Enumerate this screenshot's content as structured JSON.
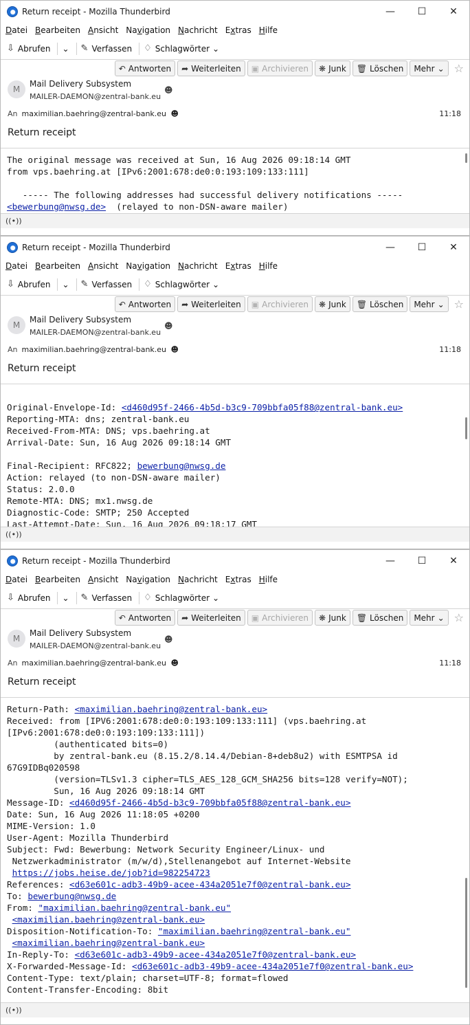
{
  "windows": [
    {
      "title": "Return receipt - Mozilla Thunderbird",
      "menu": [
        "Datei",
        "Bearbeiten",
        "Ansicht",
        "Navigation",
        "Nachricht",
        "Extras",
        "Hilfe"
      ],
      "toolbar": {
        "get": "Abrufen",
        "compose": "Verfassen",
        "tags": "Schlagwörter"
      },
      "actions": {
        "reply": "Antworten",
        "forward": "Weiterleiten",
        "archive": "Archivieren",
        "junk": "Junk",
        "delete": "Löschen",
        "more": "Mehr"
      },
      "from_name": "Mail Delivery Subsystem",
      "from_addr": "MAILER-DAEMON@zentral-bank.eu",
      "to_label": "An",
      "to_addr": "maximilian.baehring@zentral-bank.eu",
      "time": "11:18",
      "subject": "Return receipt",
      "body_lines": [
        [
          {
            "t": "The original message was received at Sun, 16 Aug 2026 09:18:14 GMT"
          }
        ],
        [
          {
            "t": "from vps.baehring.at [IPv6:2001:678:de0:0:193:109:133:111]"
          }
        ],
        [
          {
            "t": ""
          }
        ],
        [
          {
            "t": "   ----- The following addresses had successful delivery notifications -----"
          }
        ],
        [
          {
            "t": "<bewerbung@nwsg.de>",
            "link": true
          },
          {
            "t": "  (relayed to non-DSN-aware mailer)"
          }
        ]
      ]
    },
    {
      "title": "Return receipt - Mozilla Thunderbird",
      "menu": [
        "Datei",
        "Bearbeiten",
        "Ansicht",
        "Navigation",
        "Nachricht",
        "Extras",
        "Hilfe"
      ],
      "toolbar": {
        "get": "Abrufen",
        "compose": "Verfassen",
        "tags": "Schlagwörter"
      },
      "actions": {
        "reply": "Antworten",
        "forward": "Weiterleiten",
        "archive": "Archivieren",
        "junk": "Junk",
        "delete": "Löschen",
        "more": "Mehr"
      },
      "from_name": "Mail Delivery Subsystem",
      "from_addr": "MAILER-DAEMON@zentral-bank.eu",
      "to_label": "An",
      "to_addr": "maximilian.baehring@zentral-bank.eu",
      "time": "11:18",
      "subject": "Return receipt",
      "body_lines": [
        [
          {
            "t": ""
          }
        ],
        [
          {
            "t": "Original-Envelope-Id: "
          },
          {
            "t": "<d460d95f-2466-4b5d-b3c9-709bbfa05f88@zentral-bank.eu>",
            "link": true
          }
        ],
        [
          {
            "t": "Reporting-MTA: dns; zentral-bank.eu"
          }
        ],
        [
          {
            "t": "Received-From-MTA: DNS; vps.baehring.at"
          }
        ],
        [
          {
            "t": "Arrival-Date: Sun, 16 Aug 2026 09:18:14 GMT"
          }
        ],
        [
          {
            "t": ""
          }
        ],
        [
          {
            "t": "Final-Recipient: RFC822; "
          },
          {
            "t": "bewerbung@nwsg.de",
            "link": true
          }
        ],
        [
          {
            "t": "Action: relayed (to non-DSN-aware mailer)"
          }
        ],
        [
          {
            "t": "Status: 2.0.0"
          }
        ],
        [
          {
            "t": "Remote-MTA: DNS; mx1.nwsg.de"
          }
        ],
        [
          {
            "t": "Diagnostic-Code: SMTP; 250 Accepted"
          }
        ],
        [
          {
            "t": "Last-Attempt-Date: Sun, 16 Aug 2026 09:18:17 GMT"
          }
        ]
      ]
    },
    {
      "title": "Return receipt - Mozilla Thunderbird",
      "menu": [
        "Datei",
        "Bearbeiten",
        "Ansicht",
        "Navigation",
        "Nachricht",
        "Extras",
        "Hilfe"
      ],
      "toolbar": {
        "get": "Abrufen",
        "compose": "Verfassen",
        "tags": "Schlagwörter"
      },
      "actions": {
        "reply": "Antworten",
        "forward": "Weiterleiten",
        "archive": "Archivieren",
        "junk": "Junk",
        "delete": "Löschen",
        "more": "Mehr"
      },
      "from_name": "Mail Delivery Subsystem",
      "from_addr": "MAILER-DAEMON@zentral-bank.eu",
      "to_label": "An",
      "to_addr": "maximilian.baehring@zentral-bank.eu",
      "time": "11:18",
      "subject": "Return receipt",
      "body_lines": [
        [
          {
            "t": "Return-Path: "
          },
          {
            "t": "<maximilian.baehring@zentral-bank.eu>",
            "link": true
          }
        ],
        [
          {
            "t": "Received: from [IPV6:2001:678:de0:0:193:109:133:111] (vps.baehring.at"
          }
        ],
        [
          {
            "t": "[IPv6:2001:678:de0:0:193:109:133:111])"
          }
        ],
        [
          {
            "t": "         (authenticated bits=0)"
          }
        ],
        [
          {
            "t": "         by zentral-bank.eu (8.15.2/8.14.4/Debian-8+deb8u2) with ESMTPSA id"
          }
        ],
        [
          {
            "t": "67G9IDBq020598"
          }
        ],
        [
          {
            "t": "         (version=TLSv1.3 cipher=TLS_AES_128_GCM_SHA256 bits=128 verify=NOT);"
          }
        ],
        [
          {
            "t": "         Sun, 16 Aug 2026 09:18:14 GMT"
          }
        ],
        [
          {
            "t": "Message-ID: "
          },
          {
            "t": "<d460d95f-2466-4b5d-b3c9-709bbfa05f88@zentral-bank.eu>",
            "link": true
          }
        ],
        [
          {
            "t": "Date: Sun, 16 Aug 2026 11:18:05 +0200"
          }
        ],
        [
          {
            "t": "MIME-Version: 1.0"
          }
        ],
        [
          {
            "t": "User-Agent: Mozilla Thunderbird"
          }
        ],
        [
          {
            "t": "Subject: Fwd: Bewerbung: Network Security Engineer/Linux- und"
          }
        ],
        [
          {
            "t": " Netzwerkadministrator (m/w/d),Stellenangebot auf Internet-Website"
          }
        ],
        [
          {
            "t": " "
          },
          {
            "t": "https://jobs.heise.de/job?id=982254723",
            "link": true
          }
        ],
        [
          {
            "t": "References: "
          },
          {
            "t": "<d63e601c-adb3-49b9-acee-434a2051e7f0@zentral-bank.eu>",
            "link": true
          }
        ],
        [
          {
            "t": "To: "
          },
          {
            "t": "bewerbung@nwsg.de",
            "link": true
          }
        ],
        [
          {
            "t": "From: "
          },
          {
            "t": "\"maximilian.baehring@zentral-bank.eu\"",
            "link": true
          }
        ],
        [
          {
            "t": " "
          },
          {
            "t": "<maximilian.baehring@zentral-bank.eu>",
            "link": true
          }
        ],
        [
          {
            "t": "Disposition-Notification-To: "
          },
          {
            "t": "\"maximilian.baehring@zentral-bank.eu\"",
            "link": true
          }
        ],
        [
          {
            "t": " "
          },
          {
            "t": "<maximilian.baehring@zentral-bank.eu>",
            "link": true
          }
        ],
        [
          {
            "t": "In-Reply-To: "
          },
          {
            "t": "<d63e601c-adb3-49b9-acee-434a2051e7f0@zentral-bank.eu>",
            "link": true
          }
        ],
        [
          {
            "t": "X-Forwarded-Message-Id: "
          },
          {
            "t": "<d63e601c-adb3-49b9-acee-434a2051e7f0@zentral-bank.eu>",
            "link": true
          }
        ],
        [
          {
            "t": "Content-Type: text/plain; charset=UTF-8; format=flowed"
          }
        ],
        [
          {
            "t": "Content-Transfer-Encoding: 8bit"
          }
        ]
      ]
    }
  ]
}
